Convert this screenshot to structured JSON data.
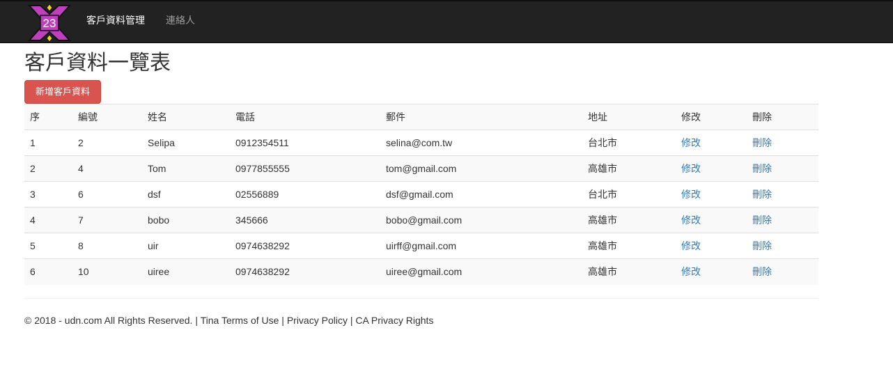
{
  "navbar": {
    "logo_text": "23",
    "brand_label": "客戶資料管理",
    "contacts_label": "連絡人"
  },
  "page": {
    "title": "客戶資料一覽表",
    "add_button_label": "新增客戶資料"
  },
  "table": {
    "headers": [
      "序",
      "編號",
      "姓名",
      "電話",
      "郵件",
      "地址",
      "修改",
      "刪除"
    ],
    "rows": [
      [
        "1",
        "2",
        "Selipa",
        "0912354511",
        "selina@com.tw",
        "台北市",
        "修改",
        "刪除"
      ],
      [
        "2",
        "4",
        "Tom",
        "0977855555",
        "tom@gmail.com",
        "高雄市",
        "修改",
        "刪除"
      ],
      [
        "3",
        "6",
        "dsf",
        "02556889",
        "dsf@gmail.com",
        "台北市",
        "修改",
        "刪除"
      ],
      [
        "4",
        "7",
        "bobo",
        "345666",
        "bobo@gmail.com",
        "高雄市",
        "修改",
        "刪除"
      ],
      [
        "5",
        "8",
        "uir",
        "0974638292",
        "uirff@gmail.com",
        "高雄市",
        "修改",
        "刪除"
      ],
      [
        "6",
        "10",
        "uiree",
        "0974638292",
        "uiree@gmail.com",
        "高雄市",
        "修改",
        "刪除"
      ]
    ]
  },
  "footer": {
    "text": "© 2018 - udn.com All Rights Reserved. | Tina Terms of Use | Privacy Policy | CA Privacy Rights"
  },
  "colors": {
    "navbar_bg": "#222222",
    "danger_button": "#d9534f",
    "link": "#337ab7",
    "logo_purple": "#c03fbf",
    "logo_yellow": "#f5d21e"
  },
  "icons": {
    "logo": "crossed-badge-logo-icon"
  }
}
